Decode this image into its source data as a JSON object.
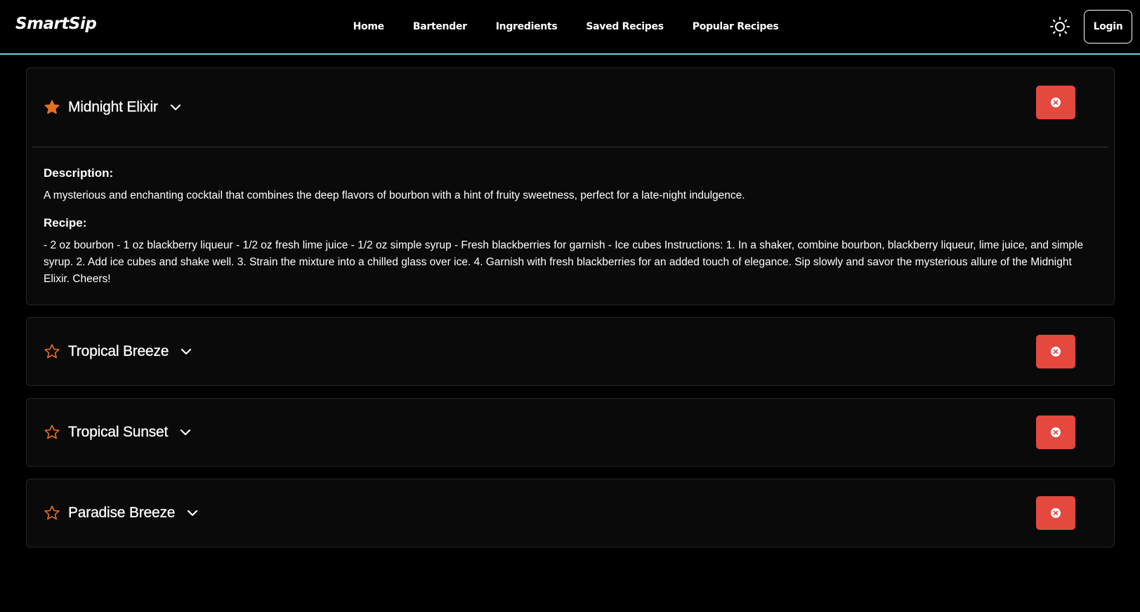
{
  "nav": {
    "logo": "SmartSip",
    "links": [
      "Home",
      "Bartender",
      "Ingredients",
      "Saved Recipes",
      "Popular Recipes"
    ],
    "login_label": "Login",
    "theme_icon": "sun-icon"
  },
  "colors": {
    "accent_border": "#6fd3df",
    "star": "#e8711f",
    "remove": "#e5483f"
  },
  "recipes": [
    {
      "name": "Midnight Elixir",
      "favorited": true,
      "expanded": true,
      "description_label": "Description:",
      "description": "A mysterious and enchanting cocktail that combines the deep flavors of bourbon with a hint of fruity sweetness, perfect for a late-night indulgence.",
      "recipe_label": "Recipe:",
      "recipe": "- 2 oz bourbon - 1 oz blackberry liqueur - 1/2 oz fresh lime juice - 1/2 oz simple syrup - Fresh blackberries for garnish - Ice cubes Instructions: 1. In a shaker, combine bourbon, blackberry liqueur, lime juice, and simple syrup. 2. Add ice cubes and shake well. 3. Strain the mixture into a chilled glass over ice. 4. Garnish with fresh blackberries for an added touch of elegance. Sip slowly and savor the mysterious allure of the Midnight Elixir. Cheers!"
    },
    {
      "name": "Tropical Breeze",
      "favorited": false,
      "expanded": false
    },
    {
      "name": "Tropical Sunset",
      "favorited": false,
      "expanded": false
    },
    {
      "name": "Paradise Breeze",
      "favorited": false,
      "expanded": false
    }
  ]
}
